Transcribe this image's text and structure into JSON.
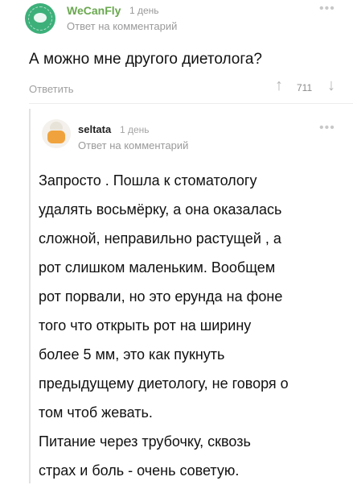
{
  "comment1": {
    "username": "WeCanFly",
    "time": "1 день",
    "reply_to": "Ответ на комментарий",
    "menu_icon": "•••",
    "text": "А можно мне другого диетолога?",
    "actions": {
      "reply_label": "Ответить",
      "vote_up_icon": "↑",
      "rating": "711",
      "vote_down_icon": "↓"
    }
  },
  "comment2": {
    "username": "seltata",
    "time": "1 день",
    "reply_to": "Ответ на комментарий",
    "menu_icon": "•••",
    "lines": [
      "Запросто . Пошла к стоматологу",
      "удалять восьмёрку, а она оказалась",
      "сложной, неправильно растущей , а",
      "рот слишком маленьким. Вообщем",
      "рот порвали, но это ерунда на фоне",
      "того что открыть рот на ширину",
      "более 5 мм, это как пукнуть",
      "предыдущему диетологу, не говоря о",
      "том чтоб жевать.",
      "Питание через трубочку, сквозь",
      "страх и боль - очень советую."
    ]
  },
  "colors": {
    "username_green": "#6aa84f",
    "avatar1_bg": "#3db07a",
    "avatar2_accent": "#f0a33c",
    "muted_text": "#9a9a9a"
  },
  "icons": {
    "menu": "more-dots-icon",
    "vote_up": "arrow-up-icon",
    "vote_down": "arrow-down-icon"
  }
}
